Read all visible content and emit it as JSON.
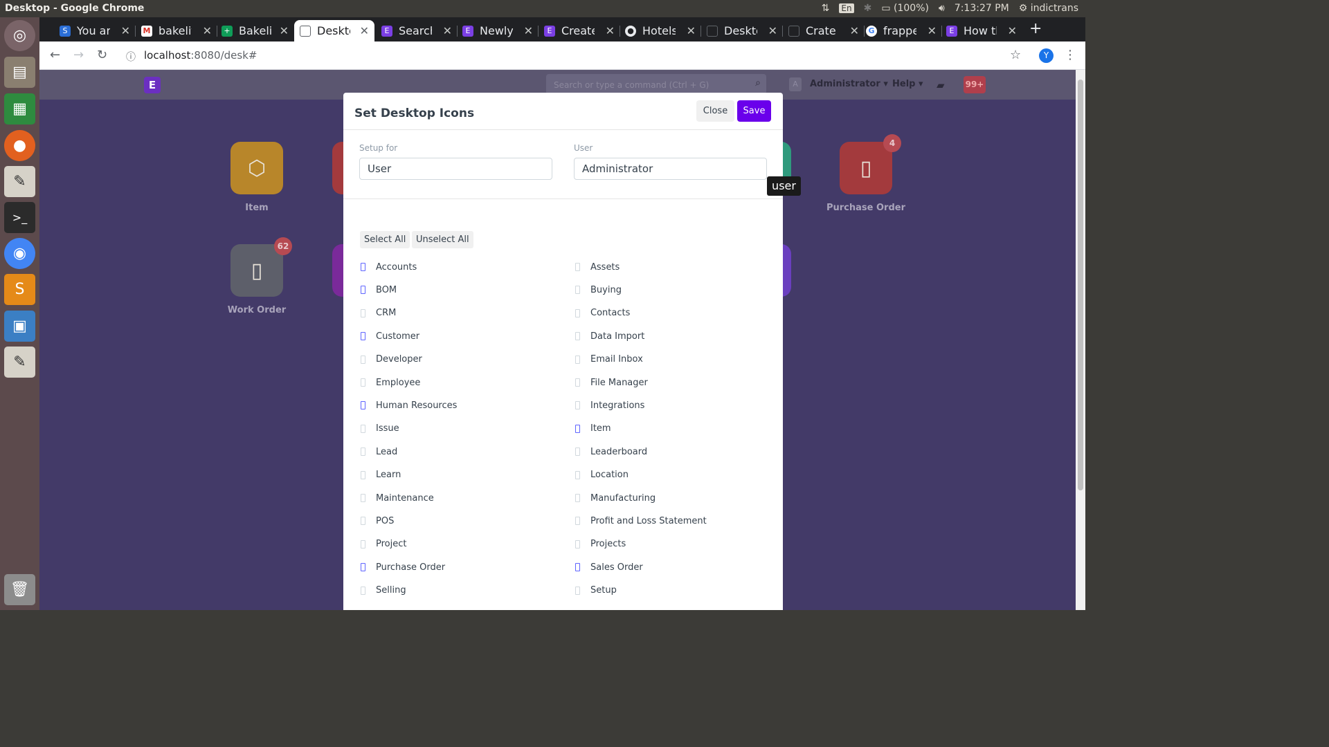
{
  "os": {
    "window_title": "Desktop - Google Chrome",
    "lang": "En",
    "battery": "(100%)",
    "clock": "7:13:27 PM",
    "user": "indictrans"
  },
  "tabs": [
    {
      "label": "You are",
      "icon": "skype-icon",
      "color": "#2b6ed6",
      "glyph": "S"
    },
    {
      "label": "bakelite",
      "icon": "gmail-icon",
      "color": "#d93025",
      "glyph": "M"
    },
    {
      "label": "Bakelite",
      "icon": "sheets-icon",
      "color": "#0f9d58",
      "glyph": "+"
    },
    {
      "label": "Desktop",
      "icon": "page-icon",
      "color": "#ffffff",
      "glyph": ""
    },
    {
      "label": "Search",
      "icon": "erpnext-icon",
      "color": "#7b3fe4",
      "glyph": "E"
    },
    {
      "label": "Newly",
      "icon": "erpnext-icon",
      "color": "#7b3fe4",
      "glyph": "E"
    },
    {
      "label": "Create",
      "icon": "erpnext-icon",
      "color": "#7b3fe4",
      "glyph": "E"
    },
    {
      "label": "Hotels",
      "icon": "github-icon",
      "color": "#e8eaed",
      "glyph": "●"
    },
    {
      "label": "Desktop",
      "icon": "page-icon",
      "color": "#202124",
      "glyph": ""
    },
    {
      "label": "Crate",
      "icon": "page-icon",
      "color": "#202124",
      "glyph": ""
    },
    {
      "label": "frappe",
      "icon": "google-icon",
      "color": "#ffffff",
      "glyph": "G"
    },
    {
      "label": "How th",
      "icon": "erpnext-icon",
      "color": "#7b3fe4",
      "glyph": "E"
    }
  ],
  "address": {
    "host": "localhost",
    "path": ":8080/desk#"
  },
  "avatar": "Y",
  "app": {
    "logo": "E",
    "search_placeholder": "Search or type a command (Ctrl + G)",
    "user_initial": "A",
    "user_menu": "Administrator",
    "help_menu": "Help",
    "notifications": "99+"
  },
  "desktop_icons": [
    {
      "label": "Item",
      "color": "#b8862a",
      "glyph": "⬡"
    },
    {
      "label": "Purchase Order",
      "color": "#a33a3d",
      "glyph": "▯",
      "badge": "4"
    },
    {
      "label": "Work Order",
      "color": "#5d5f6a",
      "glyph": "▯",
      "badge": "62"
    }
  ],
  "modal": {
    "title": "Set Desktop Icons",
    "close": "Close",
    "save": "Save",
    "setup_for_label": "Setup for",
    "setup_for_value": "User",
    "user_label": "User",
    "user_value": "Administrator",
    "select_all": "Select All",
    "unselect_all": "Unselect All",
    "left_items": [
      {
        "label": "Accounts",
        "checked": true
      },
      {
        "label": "BOM",
        "checked": true
      },
      {
        "label": "CRM",
        "checked": false
      },
      {
        "label": "Customer",
        "checked": true
      },
      {
        "label": "Developer",
        "checked": false
      },
      {
        "label": "Employee",
        "checked": false
      },
      {
        "label": "Human Resources",
        "checked": true
      },
      {
        "label": "Issue",
        "checked": false
      },
      {
        "label": "Lead",
        "checked": false
      },
      {
        "label": "Learn",
        "checked": false
      },
      {
        "label": "Maintenance",
        "checked": false
      },
      {
        "label": "POS",
        "checked": false
      },
      {
        "label": "Project",
        "checked": false
      },
      {
        "label": "Purchase Order",
        "checked": true
      },
      {
        "label": "Selling",
        "checked": false
      }
    ],
    "right_items": [
      {
        "label": "Assets",
        "checked": false
      },
      {
        "label": "Buying",
        "checked": false
      },
      {
        "label": "Contacts",
        "checked": false
      },
      {
        "label": "Data Import",
        "checked": false
      },
      {
        "label": "Email Inbox",
        "checked": false
      },
      {
        "label": "File Manager",
        "checked": false
      },
      {
        "label": "Integrations",
        "checked": false
      },
      {
        "label": "Item",
        "checked": true
      },
      {
        "label": "Leaderboard",
        "checked": false
      },
      {
        "label": "Location",
        "checked": false
      },
      {
        "label": "Manufacturing",
        "checked": false
      },
      {
        "label": "Profit and Loss Statement",
        "checked": false
      },
      {
        "label": "Projects",
        "checked": false
      },
      {
        "label": "Sales Order",
        "checked": true
      },
      {
        "label": "Setup",
        "checked": false
      }
    ]
  },
  "tooltip": "user"
}
